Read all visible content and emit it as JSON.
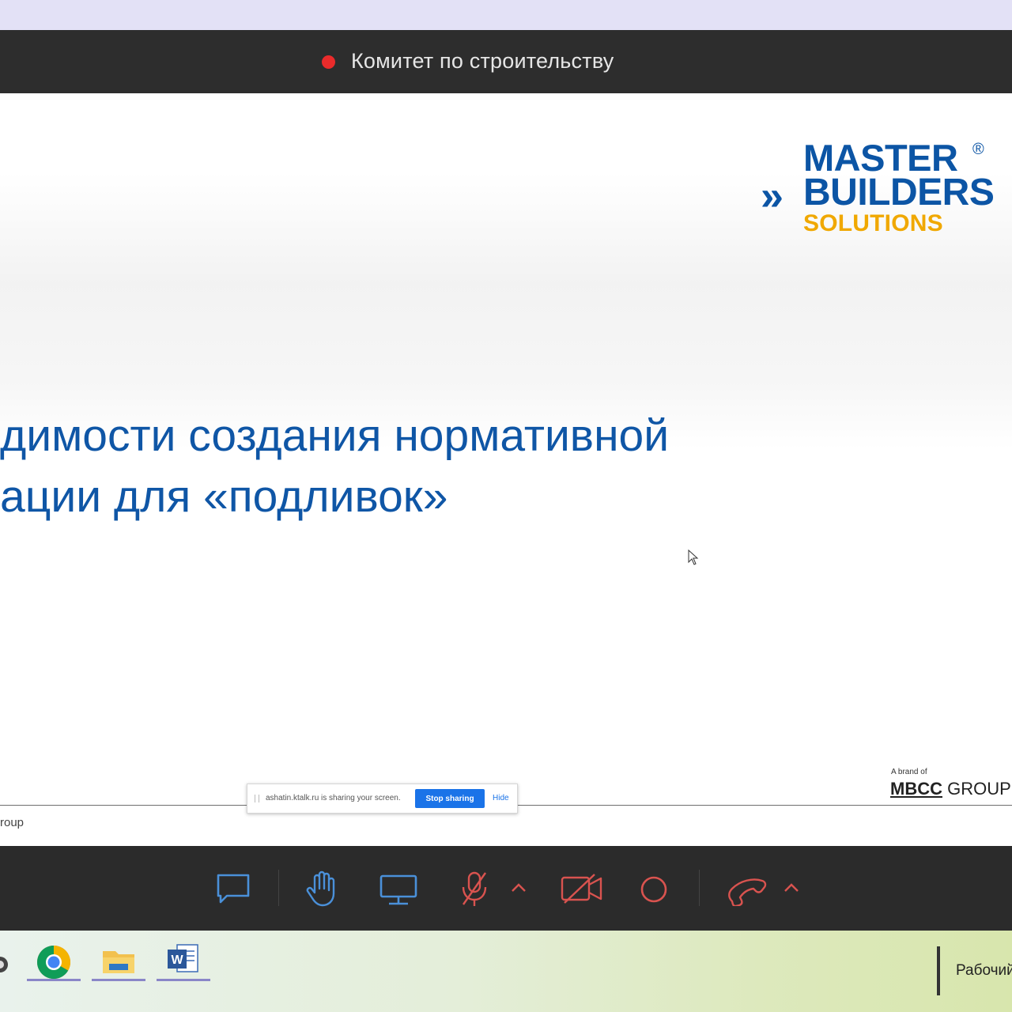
{
  "meeting": {
    "title": "Комитет по строительству",
    "recording_color": "#ea2b2b"
  },
  "slide": {
    "logo": {
      "line1": "MASTER",
      "registered": "®",
      "chevrons": "»",
      "line2": "BUILDERS",
      "line3": "SOLUTIONS"
    },
    "headline_line1": "димости создания нормативной",
    "headline_line2": "ации для «подливок»",
    "brand_caption": "A brand of",
    "brand_mbcc": "MBCC",
    "brand_group": "GROUP",
    "footer_text": "roup"
  },
  "share_bar": {
    "message": "ashatin.ktalk.ru is sharing your screen.",
    "stop_label": "Stop sharing",
    "hide_label": "Hide"
  },
  "toolbar": {
    "icons": [
      "chat-icon",
      "raise-hand-icon",
      "screen-share-icon",
      "mic-off-icon",
      "chevron-up-icon",
      "camera-off-icon",
      "record-icon",
      "hang-up-icon",
      "chevron-up-icon"
    ],
    "active_color": "#4a90d9",
    "off_color": "#d9534f"
  },
  "taskbar": {
    "apps": [
      "app-partial-icon",
      "chrome-icon",
      "file-explorer-icon",
      "word-icon"
    ],
    "desktop_label": "Рабочий"
  },
  "colors": {
    "brand_blue": "#0c55a5",
    "brand_yellow": "#f0a800",
    "headline_blue": "#0f56a6"
  }
}
